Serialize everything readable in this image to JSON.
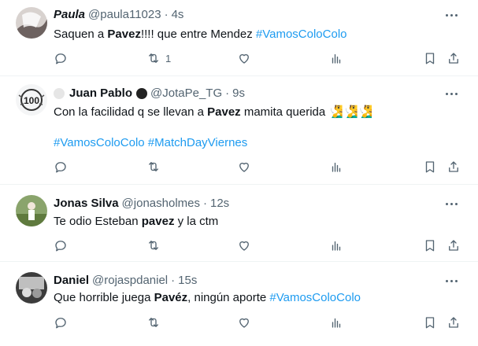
{
  "tweets": [
    {
      "name": "Paula",
      "handle": "@paula11023",
      "time": "4s",
      "text_parts": [
        "Saquen a ",
        "Pavez",
        "!!!! que entre Mendez  ",
        "#VamosColoColo"
      ],
      "retweets": "1",
      "avatar_color": "#c9c3c0"
    },
    {
      "name": "Juan Pablo",
      "handle": "@JotaPe_TG",
      "time": "9s",
      "text_parts": [
        "Con la facilidad q se llevan a ",
        "Pavez",
        " mamita querida ",
        "🧏‍♂️🧏‍♂️🧏‍♂️"
      ],
      "hashtags": [
        "#VamosColoColo",
        "#MatchDayViernes"
      ],
      "avatar_color": "#e9ecef"
    },
    {
      "name": "Jonas Silva",
      "handle": "@jonasholmes",
      "time": "12s",
      "text_parts": [
        "Te odio Esteban ",
        "pavez",
        " y la ctm"
      ],
      "avatar_color": "#6f8a5b"
    },
    {
      "name": "Daniel",
      "handle": "@rojaspdaniel",
      "time": "15s",
      "text_parts": [
        "Que horrible juega ",
        "Pavéz",
        ", ningún aporte ",
        "#VamosColoColo"
      ],
      "avatar_color": "#5a5a5a"
    }
  ],
  "colors": {
    "link": "#1d9bf0",
    "secondary": "#536471",
    "text": "#0f1419",
    "border": "#eff3f4"
  },
  "icons": [
    "reply-icon",
    "retweet-icon",
    "like-icon",
    "views-icon",
    "bookmark-icon",
    "share-icon",
    "more-icon",
    "verified-circle-icon"
  ]
}
